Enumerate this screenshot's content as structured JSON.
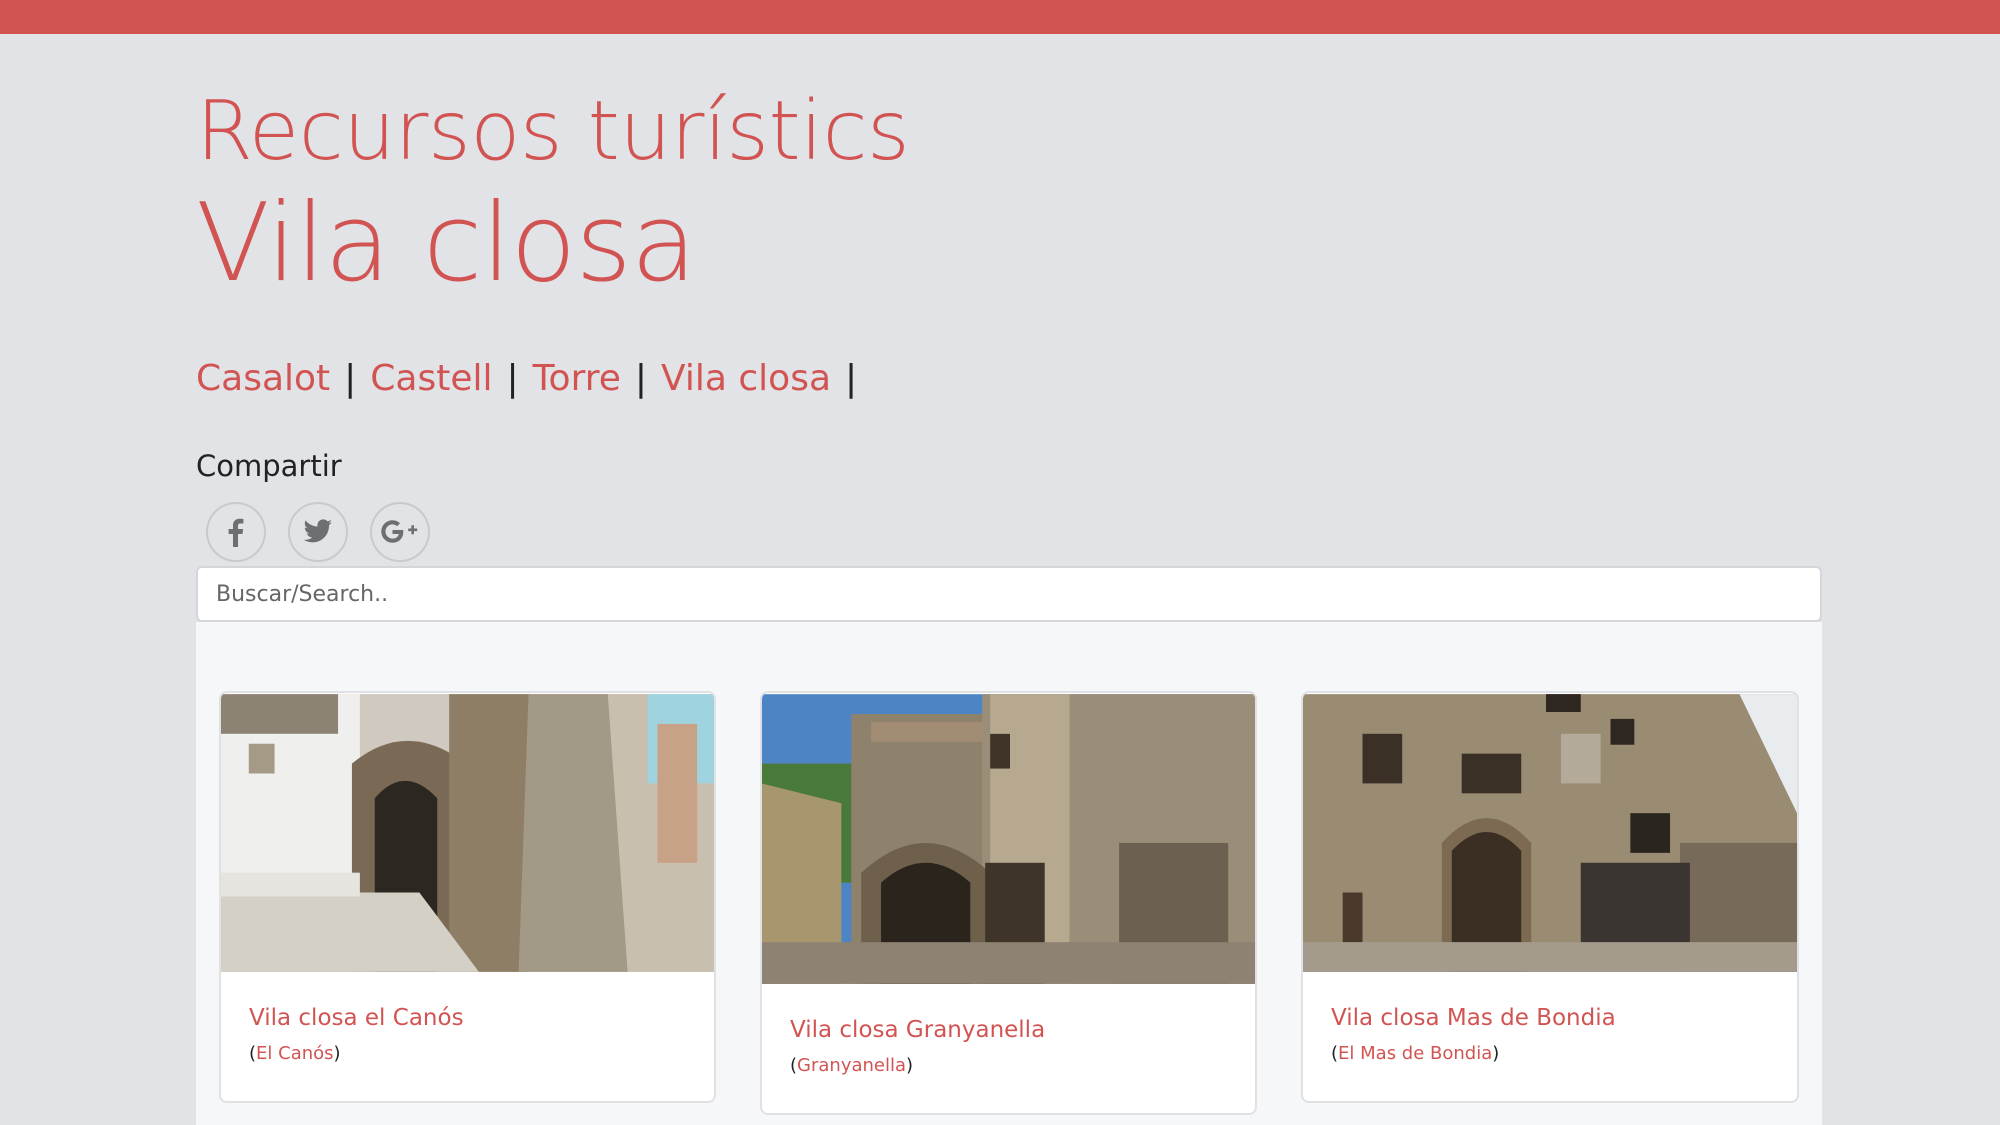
{
  "header": {
    "kicker": "Recursos turístics",
    "title": "Vila closa"
  },
  "tags": [
    {
      "label": "Casalot"
    },
    {
      "label": "Castell"
    },
    {
      "label": "Torre"
    },
    {
      "label": "Vila closa"
    }
  ],
  "tag_separator": "|",
  "share": {
    "label": "Compartir",
    "buttons": [
      {
        "icon": "facebook-icon",
        "glyph": "f"
      },
      {
        "icon": "twitter-icon",
        "glyph": "twitter bird"
      },
      {
        "icon": "google-plus-icon",
        "glyph": "G+"
      }
    ]
  },
  "search": {
    "placeholder": "Buscar/Search.."
  },
  "cards": [
    {
      "title": "Vila closa el Canós",
      "location": "El Canós",
      "open": "(",
      "close": ")"
    },
    {
      "title": "Vila closa Granyanella",
      "location": "Granyanella",
      "open": "(",
      "close": ")"
    },
    {
      "title": "Vila closa Mas de Bondia",
      "location": "El Mas de Bondia",
      "open": "(",
      "close": ")"
    }
  ],
  "colors": {
    "accent": "#d25452",
    "background": "#e1e3e6",
    "panel": "#f6f7f8"
  }
}
